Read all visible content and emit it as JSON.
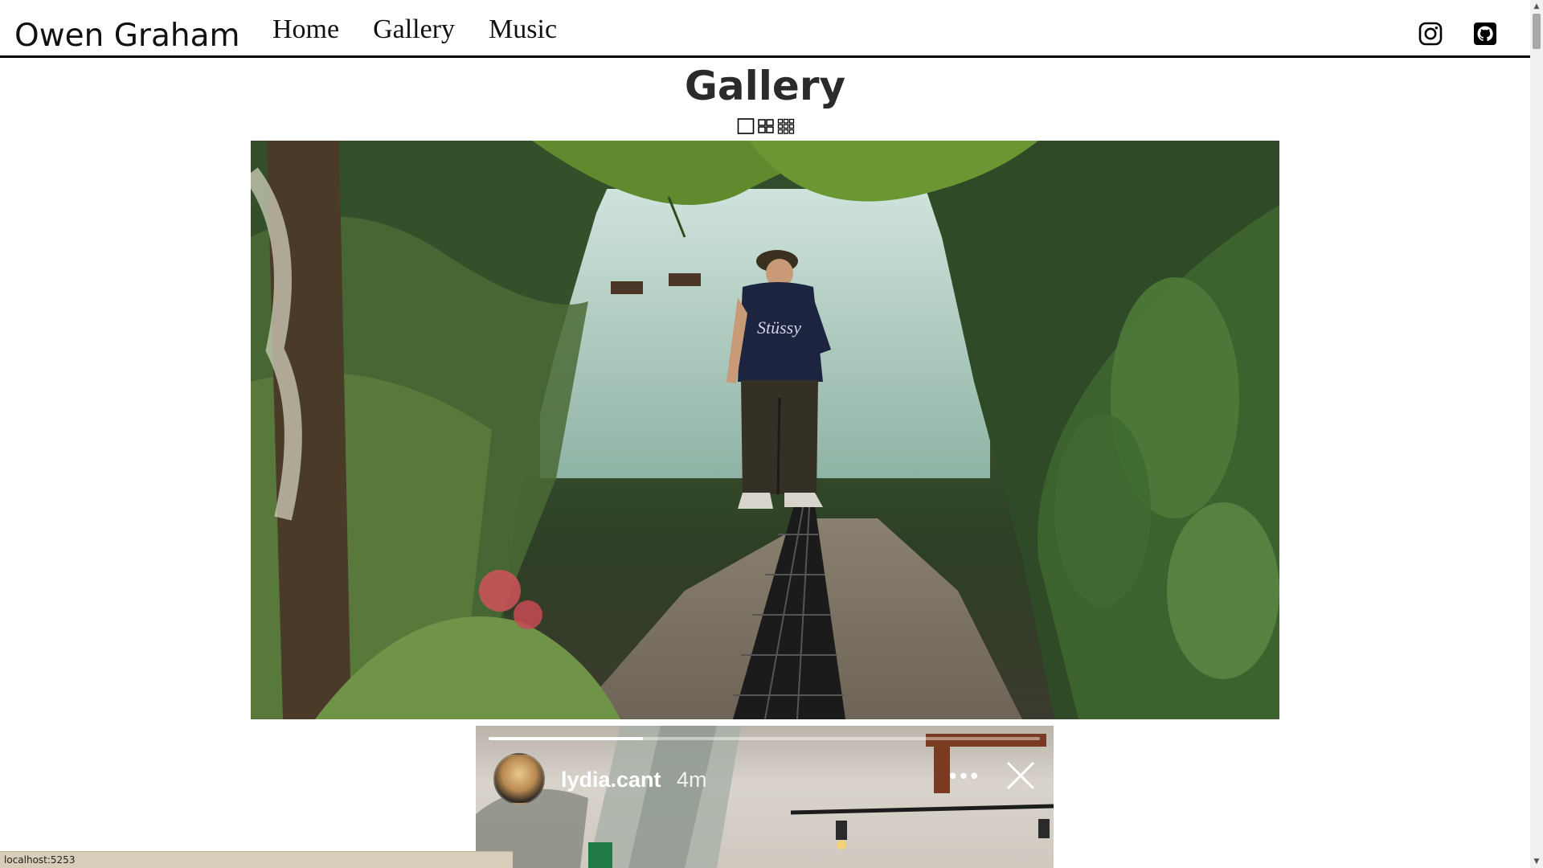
{
  "header": {
    "brand": "Owen Graham",
    "nav": [
      {
        "label": "Home"
      },
      {
        "label": "Gallery"
      },
      {
        "label": "Music"
      }
    ],
    "social_icons": [
      "instagram-icon",
      "github-icon"
    ]
  },
  "page": {
    "title": "Gallery",
    "layout_options": [
      "single-view-icon",
      "grid-2-icon",
      "grid-3-icon"
    ]
  },
  "photo": {
    "subject": "photo-jungle-greenhouse"
  },
  "story_overlay": {
    "username": "lydia.cant",
    "time_ago": "4m",
    "more_icon": "more-horizontal-icon",
    "close_icon": "close-icon",
    "progress_fraction": 0.28,
    "colors": {
      "text": "#ffffff",
      "progress_fill": "#ffffff"
    }
  },
  "status_bar": {
    "url": "localhost:5253"
  },
  "colors": {
    "header_border": "#000000",
    "status_bar_bg": "#d7cdb8",
    "scrollbar_thumb": "#a8a8a8"
  }
}
